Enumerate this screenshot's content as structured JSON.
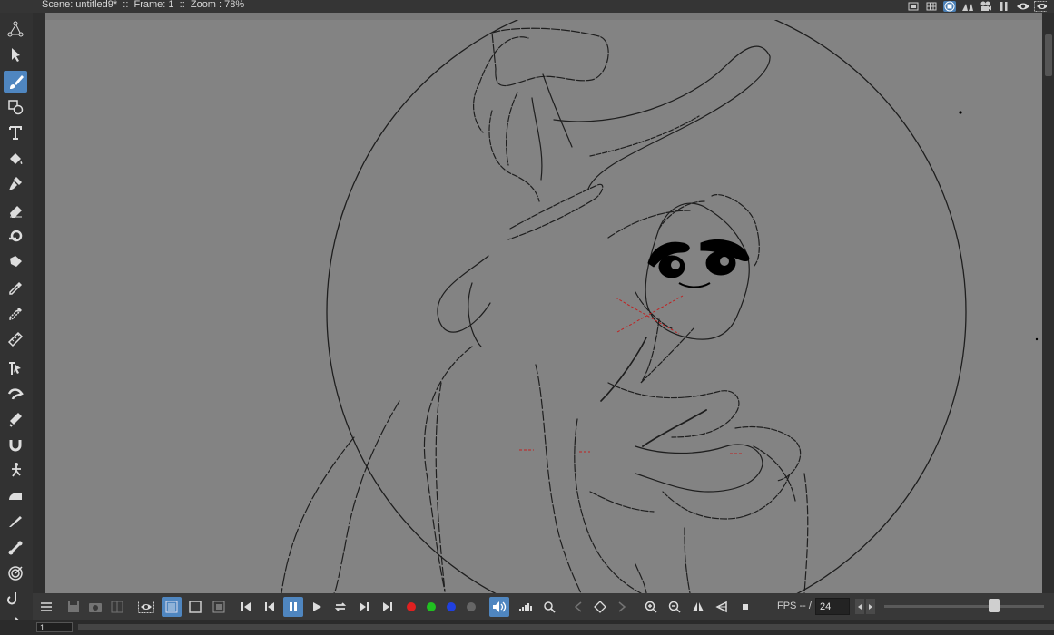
{
  "header": {
    "title": "Scene: untitled9*  ::  Frame: 1  ::  Zoom : 78%",
    "right_icons": [
      "frame-icon",
      "grid-icon",
      "stop-circle-icon",
      "flip-icon",
      "camera-icon",
      "pause-icon",
      "eye-icon",
      "eye-outline-icon"
    ]
  },
  "toolbar": {
    "tools": [
      "transform-tool",
      "select-tool",
      "brush-tool",
      "shape-tool",
      "text-tool",
      "paint-bucket-tool",
      "paint-brush-tool",
      "eraser-tool",
      "tape-tool",
      "fill-tool",
      "eyedropper-tool",
      "style-picker-tool",
      "ruler-tool",
      "control-point-tool",
      "pinch-tool",
      "pump-tool",
      "magnet-tool",
      "bender-tool",
      "iron-tool",
      "cutter-tool",
      "skeleton-tool",
      "tracker-tool",
      "hook-tool",
      "plastic-tool"
    ],
    "active_tool": "brush-tool"
  },
  "playback": {
    "fps_label": "FPS -- /",
    "fps_value": "24"
  },
  "frame_field": "1",
  "colors": {
    "accent": "#4f86c0",
    "canvas": "#838383"
  }
}
